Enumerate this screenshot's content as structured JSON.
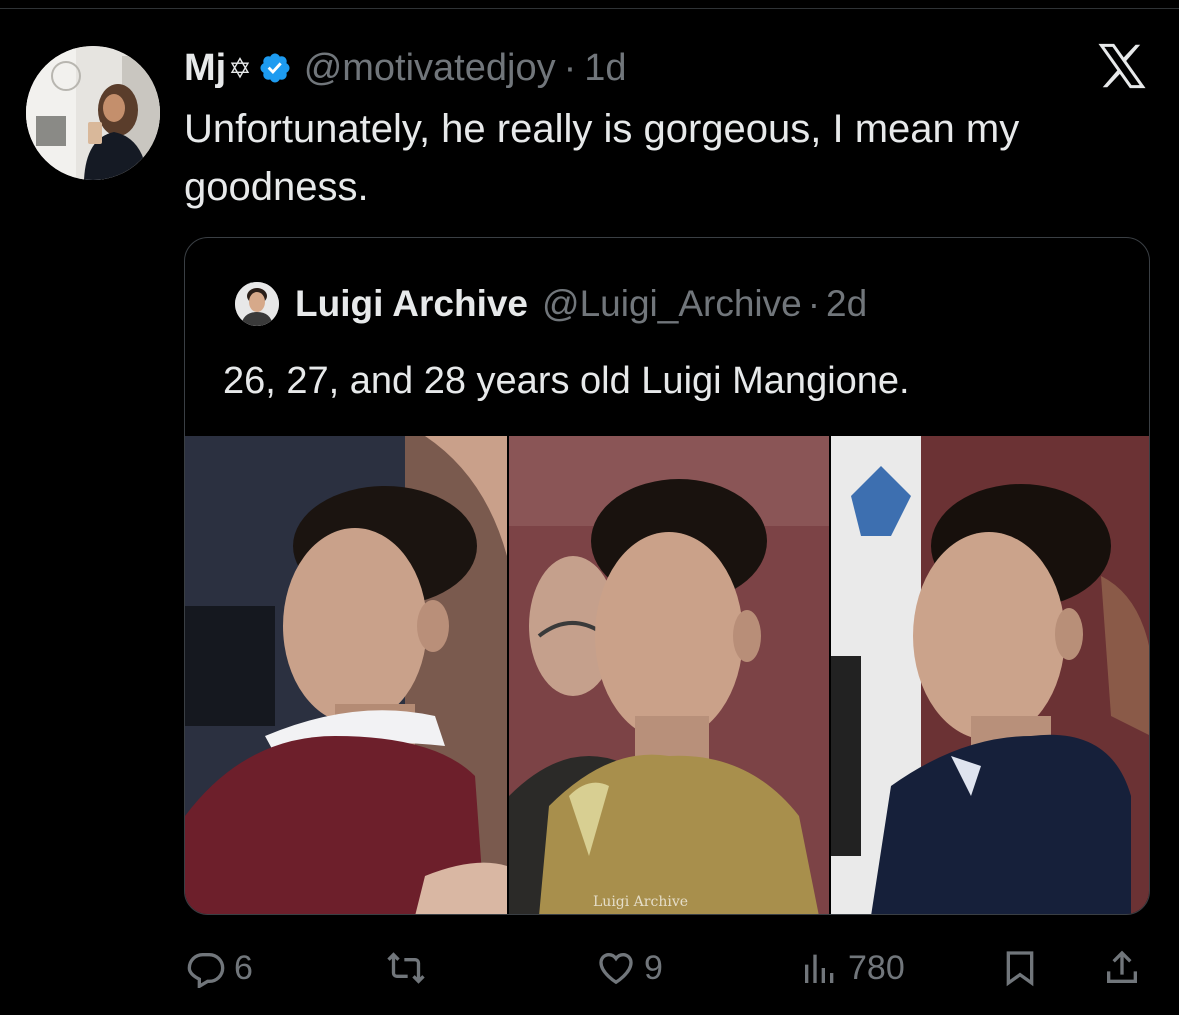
{
  "tweet": {
    "author": {
      "display_name": "Mj",
      "name_emoji": "✡",
      "handle": "@motivatedjoy",
      "time": "1d"
    },
    "separator": "·",
    "text": "Unfortunately, he really is gorgeous, I mean my goodness."
  },
  "quoted_tweet": {
    "author": {
      "display_name": "Luigi Archive",
      "handle": "@Luigi_Archive",
      "time": "2d"
    },
    "separator": "·",
    "text": "26, 27, and 28 years old Luigi Mangione.",
    "watermark": "Luigi Archive"
  },
  "actions": {
    "reply_count": "6",
    "retweet_count": "",
    "like_count": "9",
    "view_count": "780"
  },
  "colors": {
    "background": "#000000",
    "text_primary": "#e7e9ea",
    "text_secondary": "#71767b",
    "verified_blue": "#1d9bf0",
    "border": "#3a3f44"
  },
  "icons": {
    "verified": "verified-badge-icon",
    "x_logo": "x-logo-icon",
    "reply": "reply-icon",
    "retweet": "retweet-icon",
    "like": "heart-icon",
    "views": "views-icon",
    "bookmark": "bookmark-icon",
    "share": "share-icon"
  }
}
